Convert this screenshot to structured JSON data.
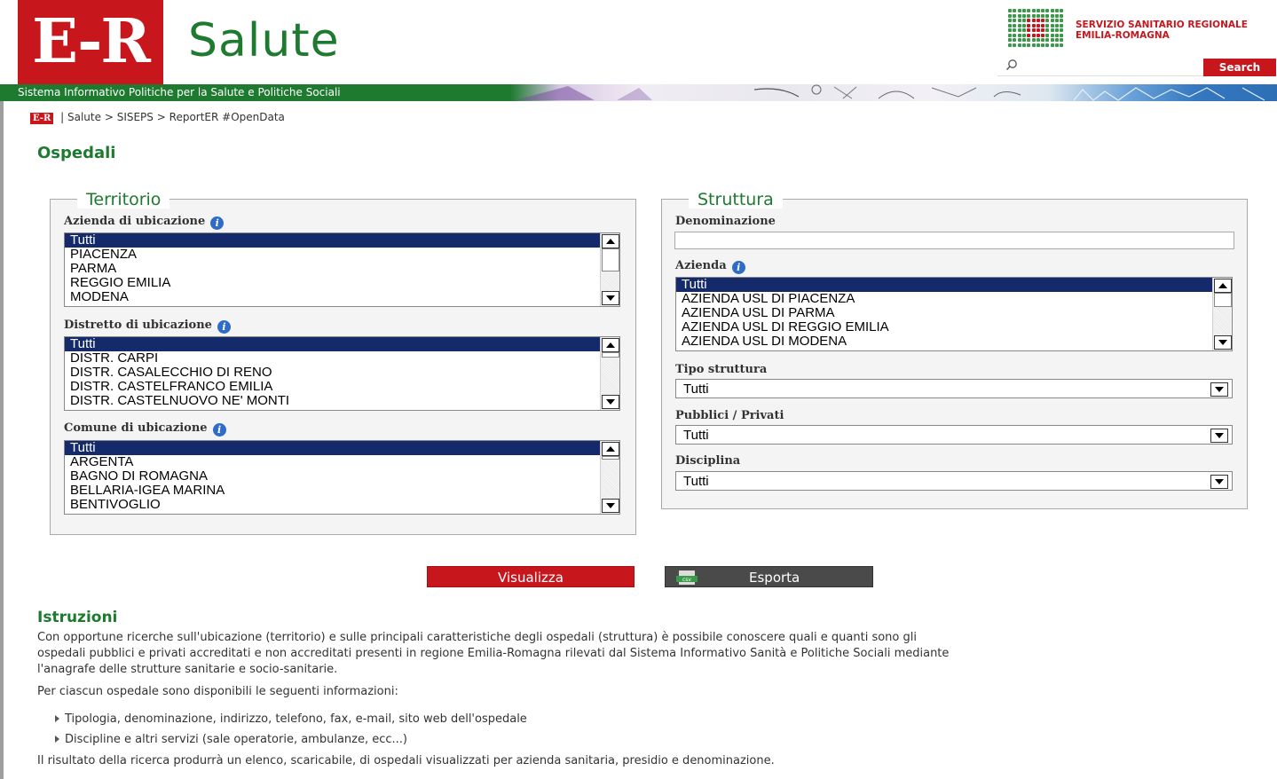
{
  "header": {
    "logo_text": "E-R",
    "site_title": "Salute",
    "ssr_line1": "SERVIZIO SANITARIO REGIONALE",
    "ssr_line2": "EMILIA-ROMAGNA",
    "search_placeholder": "",
    "search_button": "Search",
    "band_text": "Sistema Informativo Politiche per la Salute e Politiche Sociali"
  },
  "breadcrumb": {
    "logo": "E-R",
    "separator": "|",
    "items": [
      "Salute",
      "SISEPS",
      "ReportER #OpenData"
    ],
    "arrow": ">"
  },
  "page_title": "Ospedali",
  "territorio": {
    "legend": "Territorio",
    "azienda": {
      "label": "Azienda di ubicazione",
      "options": [
        "Tutti",
        "PIACENZA",
        "PARMA",
        "REGGIO EMILIA",
        "MODENA"
      ]
    },
    "distretto": {
      "label": "Distretto di ubicazione",
      "options": [
        "Tutti",
        "DISTR. CARPI",
        "DISTR. CASALECCHIO DI RENO",
        "DISTR. CASTELFRANCO EMILIA",
        "DISTR. CASTELNUOVO NE' MONTI"
      ]
    },
    "comune": {
      "label": "Comune di ubicazione",
      "options": [
        "Tutti",
        "ARGENTA",
        "BAGNO DI ROMAGNA",
        "BELLARIA-IGEA MARINA",
        "BENTIVOGLIO"
      ]
    }
  },
  "struttura": {
    "legend": "Struttura",
    "denominazione": {
      "label": "Denominazione",
      "value": ""
    },
    "azienda": {
      "label": "Azienda",
      "options": [
        "Tutti",
        "AZIENDA USL DI PIACENZA",
        "AZIENDA USL DI PARMA",
        "AZIENDA USL DI REGGIO EMILIA",
        "AZIENDA USL DI MODENA"
      ]
    },
    "tipo": {
      "label": "Tipo struttura",
      "value": "Tutti"
    },
    "pubblici": {
      "label": "Pubblici / Privati",
      "value": "Tutti"
    },
    "disciplina": {
      "label": "Disciplina",
      "value": "Tutti"
    }
  },
  "actions": {
    "visualizza": "Visualizza",
    "esporta": "Esporta",
    "csv_icon_text": "csv"
  },
  "istruzioni": {
    "title": "Istruzioni",
    "p1_line1": "Con opportune ricerche sull'ubicazione (territorio) e sulle principali caratteristiche degli ospedali (struttura) è possibile conoscere quali e quanti sono gli",
    "p1_line2": "ospedali pubblici e privati accreditati e non accreditati presenti in regione Emilia-Romagna rilevati dal Sistema Informativo Sanità e Politiche Sociali mediante",
    "p1_line3": "l'anagrafe delle strutture sanitarie e socio-sanitarie.",
    "p2": "Per ciascun ospedale sono disponibili le seguenti informazioni:",
    "bullets": [
      "Tipologia, denominazione, indirizzo, telefono, fax, e-mail, sito web dell'ospedale",
      "Discipline e altri servizi (sale operatorie, ambulanze, ecc...)"
    ],
    "p3": "Il risultato della ricerca produrrà un elenco, scaricabile, di ospedali visualizzati per azienda sanitaria, presidio e denominazione."
  },
  "colors": {
    "brand_red": "#c8161d",
    "brand_green": "#1d7a2f",
    "selection_blue": "#142a6b",
    "info_blue": "#2f6cc7"
  }
}
